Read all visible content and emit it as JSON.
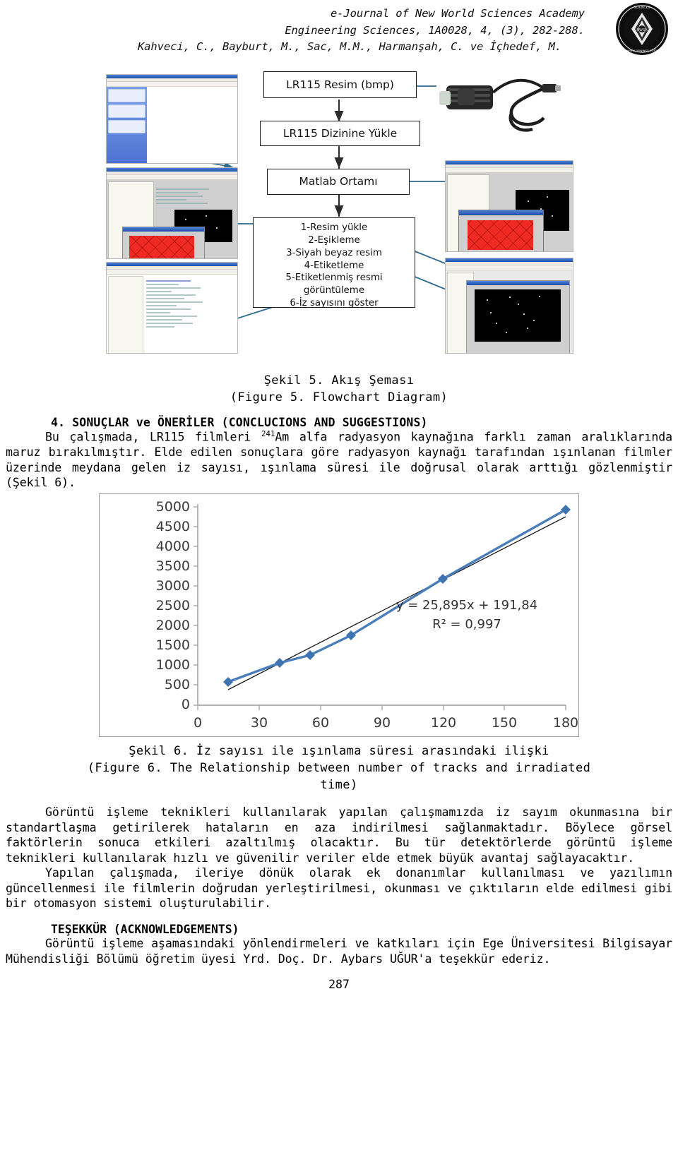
{
  "header": {
    "line1": "e-Journal of New World Sciences Academy",
    "line2": "Engineering Sciences, 1A0028, 4, (3), 282-288.",
    "line3": "Kahveci, C., Bayburt, M., Sac, M.M., Harmanşah, C. ve İçhedef, M.",
    "logo_name": "world-sciences-academy-logo"
  },
  "figure5": {
    "boxes": {
      "image": "LR115 Resim (bmp)",
      "load": "LR115 Dizinine Yükle",
      "matlab": "Matlab Ortamı",
      "steps": "1-Resim yükle\n2-Eşikleme\n3-Siyah beyaz resim\n4-Etiketleme\n5-Etiketlenmiş resmi\ngörüntüleme\n6-İz sayısını göster"
    },
    "steps_list": [
      "1-Resim yükle",
      "2-Eşikleme",
      "3-Siyah beyaz resim",
      "4-Etiketleme",
      "5-Etiketlenmiş resmi",
      "görüntüleme",
      "6-İz sayısını göster"
    ],
    "caption_tr": "Şekil 5. Akış Şeması",
    "caption_en": "(Figure 5. Flowchart Diagram)",
    "thumbnails": [
      "explorer-window-screenshot",
      "matlab-editor-screenshot",
      "matlab-code-screenshot",
      "usb-microscope-photo",
      "matlab-red-film-screenshot",
      "matlab-track-image-screenshot"
    ]
  },
  "section4": {
    "heading": "4. SONUÇLAR ve ÖNERİLER (CONCLUCIONS AND SUGGESTIONS)",
    "para1_a": "Bu çalışmada, LR115 filmleri ",
    "para1_sup": "241",
    "para1_b": "Am alfa radyasyon kaynağına farklı zaman aralıklarında maruz bırakılmıştır. Elde edilen sonuçlara göre radyasyon kaynağı tarafından ışınlanan filmler üzerinde meydana gelen iz sayısı, ışınlama süresi ile doğrusal olarak arttığı gözlenmiştir (Şekil 6)."
  },
  "figure6": {
    "caption_tr": "Şekil 6. İz sayısı ile ışınlama süresi arasındaki ilişki",
    "caption_en_1": "(Figure 6. The Relationship between number of tracks and irradiated",
    "caption_en_2": "time)"
  },
  "chart_data": {
    "type": "line",
    "title": "",
    "xlabel": "",
    "ylabel": "",
    "x": [
      15,
      40,
      55,
      75,
      120,
      180
    ],
    "values": [
      580,
      1075,
      1270,
      1755,
      3185,
      4930
    ],
    "series": [
      {
        "name": "İz sayısı",
        "values": [
          580,
          1075,
          1270,
          1755,
          3185,
          4930
        ],
        "color": "#4a7ebb",
        "marker": "diamond"
      }
    ],
    "trendline": {
      "type": "linear",
      "equation": "y = 25,895x + 191,84",
      "r2": "R² = 0,997",
      "slope": 25.895,
      "intercept": 191.84,
      "color": "#1a1a1a",
      "style": "thin-solid"
    },
    "xlim": [
      0,
      180
    ],
    "ylim": [
      0,
      5000
    ],
    "xticks": [
      0,
      30,
      60,
      90,
      120,
      150,
      180
    ],
    "xtick_labels": [
      "0",
      "30",
      "60",
      "90",
      "120",
      "150",
      "180"
    ],
    "yticks": [
      0,
      500,
      1000,
      1500,
      2000,
      2500,
      3000,
      3500,
      4000,
      4500,
      5000
    ],
    "ytick_labels": [
      "0",
      "500",
      "1000",
      "1500",
      "2000",
      "2500",
      "3000",
      "3500",
      "4000",
      "4500",
      "5000"
    ],
    "grid": false,
    "legend": "none"
  },
  "conclusion": {
    "para2": "Görüntü işleme teknikleri kullanılarak yapılan çalışmamızda iz sayım okunmasına bir standartlaşma getirilerek hataların en aza indirilmesi sağlanmaktadır. Böylece görsel faktörlerin sonuca etkileri azaltılmış olacaktır. Bu tür detektörlerde görüntü işleme teknikleri kullanılarak hızlı ve güvenilir veriler elde etmek büyük avantaj sağlayacaktır.",
    "para3": "Yapılan çalışmada, ileriye dönük olarak ek donanımlar kullanılması ve yazılımın güncellenmesi ile filmlerin doğrudan yerleştirilmesi, okunması ve çıktıların elde edilmesi gibi bir otomasyon sistemi oluşturulabilir."
  },
  "acknowledgements": {
    "heading": "TEŞEKKÜR (ACKNOWLEDGEMENTS)",
    "text": "Görüntü işleme aşamasındaki yönlendirmeleri ve katkıları için Ege Üniversitesi Bilgisayar Mühendisliği Bölümü öğretim üyesi Yrd. Doç. Dr. Aybars UĞUR'a teşekkür ederiz."
  },
  "footer": {
    "page_number": "287"
  }
}
